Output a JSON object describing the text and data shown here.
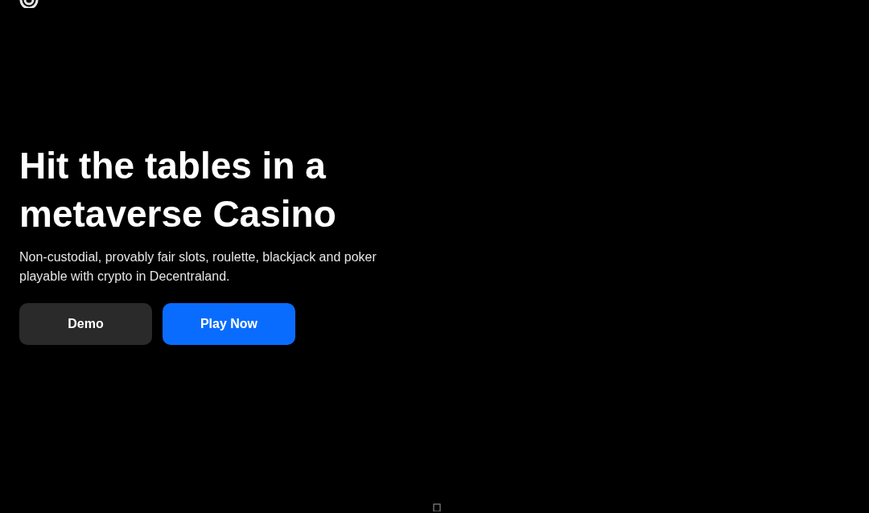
{
  "hero": {
    "title_lines": [
      "Hit the tables in a",
      "metaverse Casino"
    ],
    "description": "Non-custodial, provably fair slots, roulette, blackjack and poker playable with crypto in Decentraland.",
    "buttons": [
      {
        "label": "Demo",
        "kind": "secondary"
      },
      {
        "label": "Play Now",
        "kind": "primary"
      }
    ]
  }
}
